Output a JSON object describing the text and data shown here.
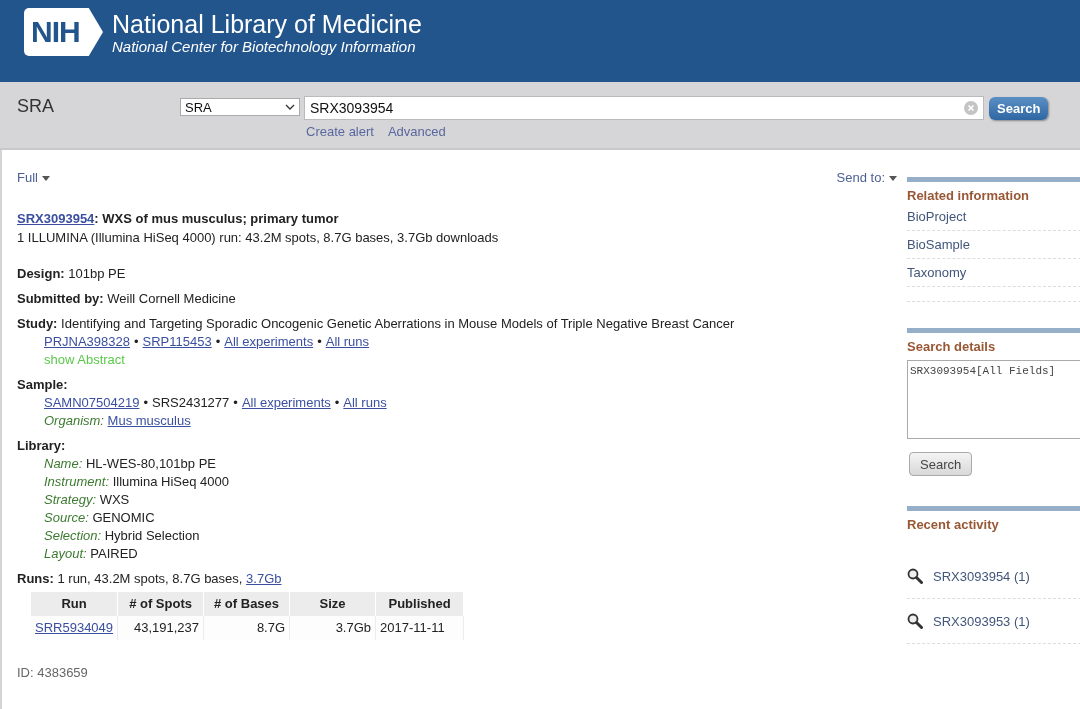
{
  "header": {
    "logo": "NIH",
    "title": "National Library of Medicine",
    "subtitle": "National Center for Biotechnology Information"
  },
  "search_bar": {
    "database_label": "SRA",
    "database_select": "SRA",
    "query": "SRX3093954",
    "button": "Search",
    "links": [
      "Create alert",
      "Advanced"
    ]
  },
  "toolbar": {
    "format": "Full",
    "send_to": "Send to:"
  },
  "record": {
    "accession": "SRX3093954",
    "title_rest": ": WXS of mus musculus; primary tumor",
    "summary": "1 ILLUMINA (Illumina HiSeq 4000) run: 43.2M spots, 8.7G bases, 3.7Gb downloads",
    "sections": [
      {
        "kind": "inline",
        "label": "Design:",
        "value": "101bp PE"
      },
      {
        "kind": "inline",
        "label": "Submitted by:",
        "value": "Weill Cornell Medicine"
      },
      {
        "kind": "block",
        "label": "Study:",
        "value": "Identifying and Targeting Sporadic Oncogenic Genetic Aberrations in Mouse Models of Triple Negative Breast Cancer",
        "lines": [
          {
            "kind": "links",
            "items": [
              {
                "kind": "link",
                "text": "PRJNA398328"
              },
              {
                "kind": "sep",
                "text": "•"
              },
              {
                "kind": "link",
                "text": "SRP115453"
              },
              {
                "kind": "sep",
                "text": "•"
              },
              {
                "kind": "link",
                "text": "All experiments"
              },
              {
                "kind": "sep",
                "text": "•"
              },
              {
                "kind": "link",
                "text": "All runs"
              }
            ]
          },
          {
            "kind": "toggle",
            "text": "show Abstract"
          }
        ]
      },
      {
        "kind": "block",
        "label": "Sample:",
        "lines": [
          {
            "kind": "links",
            "items": [
              {
                "kind": "link",
                "text": "SAMN07504219"
              },
              {
                "kind": "sep",
                "text": "•"
              },
              {
                "kind": "text",
                "text": "SRS2431277"
              },
              {
                "kind": "sep",
                "text": "•"
              },
              {
                "kind": "link",
                "text": "All experiments"
              },
              {
                "kind": "sep",
                "text": "•"
              },
              {
                "kind": "link",
                "text": "All runs"
              }
            ]
          },
          {
            "kind": "link_field",
            "label": "Organism:",
            "value": "Mus musculus"
          }
        ]
      },
      {
        "kind": "block",
        "label": "Library:",
        "lines": [
          {
            "kind": "field",
            "label": "Name:",
            "value": "HL-WES-80,101bp PE"
          },
          {
            "kind": "field",
            "label": "Instrument:",
            "value": "Illumina HiSeq 4000"
          },
          {
            "kind": "field",
            "label": "Strategy:",
            "value": "WXS"
          },
          {
            "kind": "field",
            "label": "Source:",
            "value": "GENOMIC"
          },
          {
            "kind": "field",
            "label": "Selection:",
            "value": "Hybrid Selection"
          },
          {
            "kind": "field",
            "label": "Layout:",
            "value": "PAIRED"
          }
        ]
      },
      {
        "kind": "runs",
        "label": "Runs:",
        "value": "1 run, 43.2M spots, 8.7G bases,",
        "link": "3.7Gb",
        "table": {
          "columns": [
            "Run",
            "# of Spots",
            "# of Bases",
            "Size",
            "Published"
          ],
          "rows": [
            {
              "cells": [
                {
                  "kind": "link",
                  "text": "SRR5934049"
                },
                {
                  "kind": "text",
                  "text": "43,191,237"
                },
                {
                  "kind": "text",
                  "text": "8.7G"
                },
                {
                  "kind": "text",
                  "text": "3.7Gb"
                },
                {
                  "kind": "text",
                  "text": "2017-11-11"
                }
              ]
            }
          ]
        }
      }
    ],
    "id": "ID: 4383659"
  },
  "sidebar": {
    "sections": [
      {
        "kind": "links",
        "heading": "Related information",
        "items": [
          "BioProject",
          "BioSample",
          "Taxonomy"
        ]
      },
      {
        "kind": "details",
        "heading": "Search details",
        "value": "SRX3093954[All Fields]",
        "button": "Search"
      },
      {
        "kind": "recent",
        "heading": "Recent activity",
        "items": [
          "SRX3093954 (1)",
          "SRX3093953 (1)"
        ]
      }
    ]
  }
}
